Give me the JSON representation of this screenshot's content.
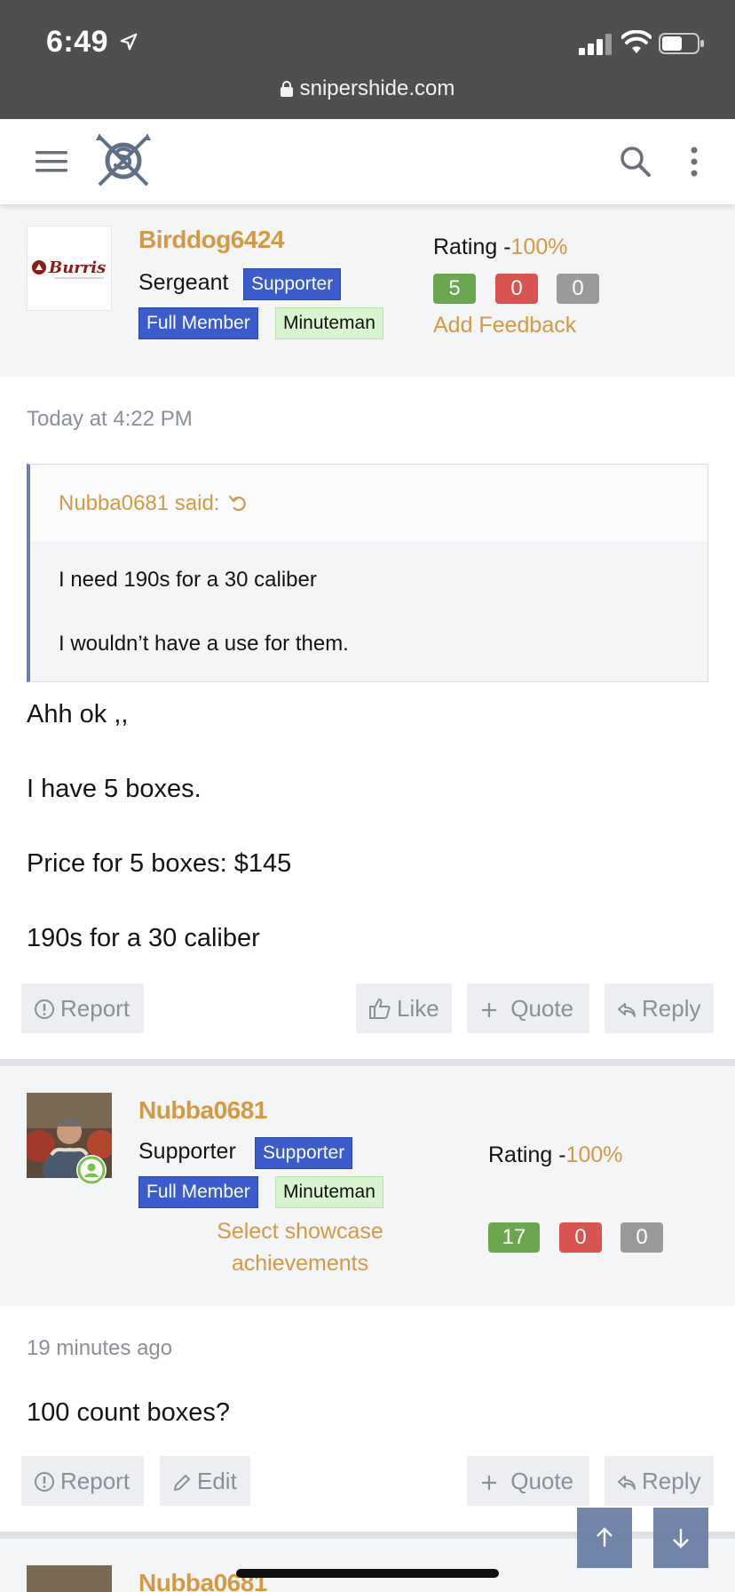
{
  "status_bar": {
    "time": "6:49",
    "url": "snipershide.com"
  },
  "nav": {
    "menu_icon": "hamburger-icon",
    "logo": "snipershide-logo",
    "search_icon": "search-icon",
    "more_icon": "kebab-icon"
  },
  "post1": {
    "username": "Birddog6424",
    "title": "Sergeant",
    "badges": [
      "Supporter",
      "Full Member",
      "Minuteman"
    ],
    "rating_label": "Rating -",
    "rating_pct": "100%",
    "counts": [
      "5",
      "0",
      "0"
    ],
    "feedback_link": "Add Feedback",
    "avatar_text": "Burris",
    "timestamp": "Today at 4:22 PM",
    "quote": {
      "author": "Nubba0681 said:",
      "lines": [
        "I need 190s for a 30 caliber",
        "I wouldn’t have a use for them."
      ]
    },
    "body": [
      "Ahh ok ,,",
      "I have 5 boxes.",
      "Price for 5 boxes: $145",
      "190s for a 30 caliber"
    ],
    "actions": {
      "report": "Report",
      "like": "Like",
      "quote": "Quote",
      "reply": "Reply"
    }
  },
  "post2": {
    "username": "Nubba0681",
    "title": "Supporter",
    "badges": [
      "Supporter",
      "Full Member",
      "Minuteman"
    ],
    "rating_label": "Rating -",
    "rating_pct": "100%",
    "counts": [
      "17",
      "0",
      "0"
    ],
    "showcase_line1": "Select showcase",
    "showcase_line2": "achievements",
    "timestamp": "19 minutes ago",
    "body": [
      "100 count boxes?"
    ],
    "actions": {
      "report": "Report",
      "edit": "Edit",
      "quote": "Quote",
      "reply": "Reply"
    }
  },
  "post3": {
    "username": "Nubba0681"
  },
  "colors": {
    "accent": "#d39a44",
    "badge_blue": "#3a5ccc",
    "badge_green": "#d8f5cf",
    "positive": "#6aa84f",
    "negative": "#d9534f",
    "neutral": "#9a9a9a"
  }
}
